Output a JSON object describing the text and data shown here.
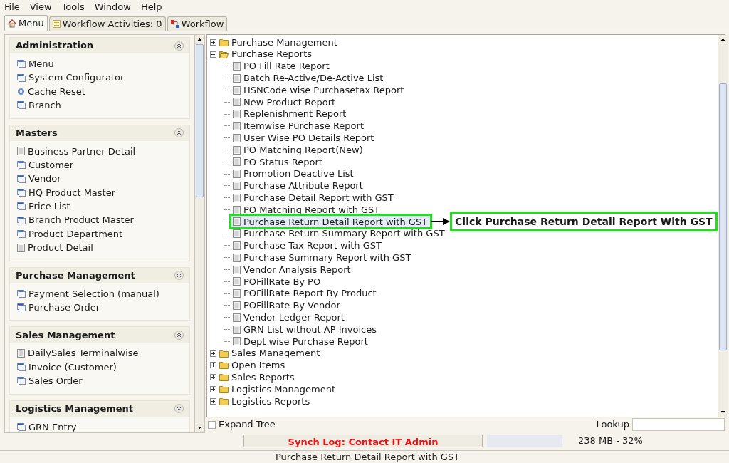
{
  "menu_bar": [
    "File",
    "View",
    "Tools",
    "Window",
    "Help"
  ],
  "tabs": [
    {
      "label": "Menu",
      "kind": "home",
      "selected": true
    },
    {
      "label": "Workflow Activities: 0",
      "kind": "list",
      "selected": false
    },
    {
      "label": "Workflow",
      "kind": "flow",
      "selected": false
    }
  ],
  "sidebar": {
    "sections": [
      {
        "title": "Administration",
        "items": [
          {
            "label": "Menu",
            "kind": "window"
          },
          {
            "label": "System Configurator",
            "kind": "window"
          },
          {
            "label": "Cache Reset",
            "kind": "process"
          },
          {
            "label": "Branch",
            "kind": "window"
          }
        ]
      },
      {
        "title": "Masters",
        "items": [
          {
            "label": "Business Partner Detail",
            "kind": "report"
          },
          {
            "label": "Customer",
            "kind": "window"
          },
          {
            "label": "Vendor",
            "kind": "window"
          },
          {
            "label": "HQ Product Master",
            "kind": "window"
          },
          {
            "label": "Price List",
            "kind": "window"
          },
          {
            "label": "Branch Product Master",
            "kind": "window"
          },
          {
            "label": "Product Department",
            "kind": "window"
          },
          {
            "label": "Product Detail",
            "kind": "report"
          }
        ]
      },
      {
        "title": "Purchase Management",
        "items": [
          {
            "label": "Payment Selection (manual)",
            "kind": "window"
          },
          {
            "label": "Purchase Order",
            "kind": "window"
          }
        ]
      },
      {
        "title": "Sales Management",
        "items": [
          {
            "label": "DailySales Terminalwise",
            "kind": "report"
          },
          {
            "label": "Invoice (Customer)",
            "kind": "window"
          },
          {
            "label": "Sales Order",
            "kind": "window"
          }
        ]
      },
      {
        "title": "Logistics Management",
        "items": [
          {
            "label": "GRN Entry",
            "kind": "window"
          }
        ]
      }
    ]
  },
  "tree": [
    {
      "label": "Purchase Management",
      "expanded": false
    },
    {
      "label": "Purchase Reports",
      "expanded": true,
      "children": [
        {
          "label": "PO Fill Rate Report",
          "selected": false
        },
        {
          "label": "Batch Re-Active/De-Active List",
          "selected": false
        },
        {
          "label": "HSNCode wise Purchasetax Report",
          "selected": false
        },
        {
          "label": "New Product Report",
          "selected": false
        },
        {
          "label": "Replenishment Report",
          "selected": false
        },
        {
          "label": "Itemwise Purchase Report",
          "selected": false
        },
        {
          "label": "User Wise PO Details Report",
          "selected": false
        },
        {
          "label": "PO Matching Report(New)",
          "selected": false
        },
        {
          "label": "PO Status Report",
          "selected": false
        },
        {
          "label": "Promotion Deactive List",
          "selected": false
        },
        {
          "label": "Purchase Attribute Report",
          "selected": false
        },
        {
          "label": "Purchase Detail Report with GST",
          "selected": false
        },
        {
          "label": "PO Matching Report with GST",
          "selected": false
        },
        {
          "label": "Purchase Return Detail Report with GST",
          "selected": true,
          "callout": "Click Purchase Return Detail Report With GST"
        },
        {
          "label": "Purchase Return Summary Report with GST",
          "selected": false
        },
        {
          "label": "Purchase Tax Report with GST",
          "selected": false
        },
        {
          "label": "Purchase Summary Report with GST",
          "selected": false
        },
        {
          "label": "Vendor Analysis Report",
          "selected": false
        },
        {
          "label": "POFillRate By PO",
          "selected": false
        },
        {
          "label": "POFillRate Report By Product",
          "selected": false
        },
        {
          "label": "POFillRate By Vendor",
          "selected": false
        },
        {
          "label": "Vendor Ledger Report",
          "selected": false
        },
        {
          "label": "GRN List without AP Invoices",
          "selected": false
        },
        {
          "label": "Dept wise Purchase Report",
          "selected": false
        }
      ]
    },
    {
      "label": "Sales Management",
      "expanded": false
    },
    {
      "label": "Open Items",
      "expanded": false
    },
    {
      "label": "Sales Reports",
      "expanded": false
    },
    {
      "label": "Logistics Management",
      "expanded": false
    },
    {
      "label": "Logistics Reports",
      "expanded": false
    }
  ],
  "expand_tree": {
    "label": "Expand Tree",
    "checked": false
  },
  "lookup": {
    "label": "Lookup"
  },
  "status_bar": {
    "sync_log": "Synch Log: Contact IT Admin",
    "memory": "238 MB - 32%",
    "message": "Purchase Return Detail Report with GST"
  }
}
